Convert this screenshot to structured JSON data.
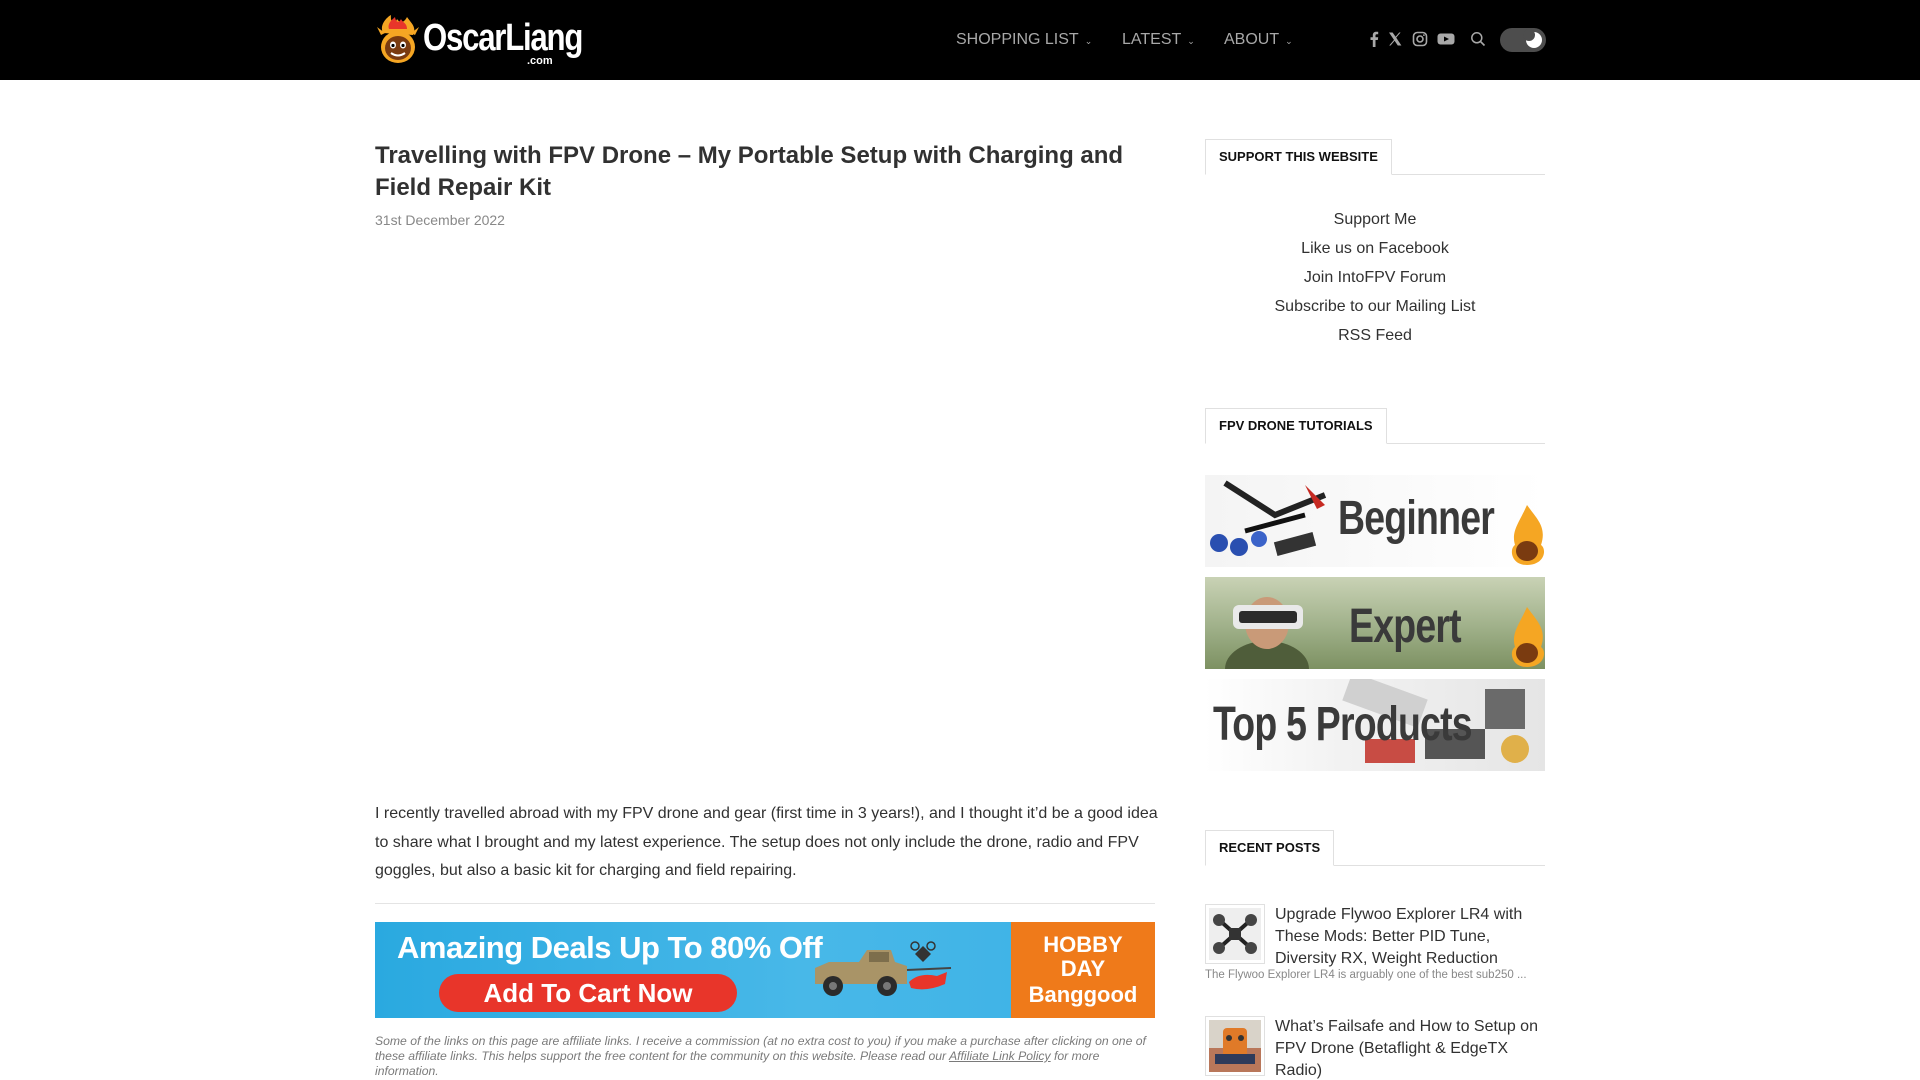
{
  "header": {
    "logo_text": "OscarLiang",
    "logo_suffix": ".com",
    "nav": [
      {
        "label": "SHOPPING LIST"
      },
      {
        "label": "LATEST"
      },
      {
        "label": "ABOUT"
      }
    ],
    "social_icons": [
      "facebook-icon",
      "x-icon",
      "instagram-icon",
      "youtube-icon",
      "search-icon"
    ],
    "theme_toggle": "dark-mode-toggle"
  },
  "article": {
    "title": "Travelling with FPV Drone – My Portable Setup with Charging and Field Repair Kit",
    "date": "31st December 2022",
    "intro": "I recently travelled abroad with my FPV drone and gear (first time in 3 years!), and I thought it’d be a good idea to share what I brought and my latest experience. The setup does not only include the drone, radio and FPV goggles, but also a basic kit for charging and field repairing.",
    "banner": {
      "headline": "Amazing Deals Up To 80% Off",
      "button": "Add To Cart Now",
      "badge_line1": "HOBBY",
      "badge_line2": "DAY",
      "brand": "Banggood"
    },
    "affiliate_text": "Some of the links on this page are affiliate links. I receive a commission (at no extra cost to you) if you make a purchase after clicking on one of these affiliate links. This helps support the free content for the community on this website. Please read our ",
    "affiliate_link": "Affiliate Link Policy",
    "affiliate_tail": " for more information."
  },
  "sidebar": {
    "support": {
      "heading": "SUPPORT THIS WEBSITE",
      "links": [
        "Support Me",
        "Like us on Facebook",
        "Join IntoFPV Forum",
        "Subscribe to our Mailing List",
        "RSS Feed"
      ]
    },
    "tutorials": {
      "heading": "FPV DRONE TUTORIALS",
      "items": [
        "Beginner",
        "Expert",
        "Top 5 Products"
      ]
    },
    "recent": {
      "heading": "RECENT POSTS",
      "posts": [
        {
          "title": "Upgrade Flywoo Explorer LR4 with These Mods: Better PID Tune, Diversity RX, Weight Reduction",
          "excerpt": "The Flywoo Explorer LR4 is arguably one of the best sub250 ..."
        },
        {
          "title": "What’s Failsafe and How to Setup on FPV Drone (Betaflight & EdgeTX Radio)",
          "excerpt": ""
        }
      ]
    }
  },
  "colors": {
    "header_bg": "#000000",
    "nav_text": "#a8a8a8",
    "banner_blue": "#2aa9e0",
    "banner_red": "#e8352a",
    "banner_orange": "#ef7a1a",
    "logo_orange": "#f5a623"
  }
}
